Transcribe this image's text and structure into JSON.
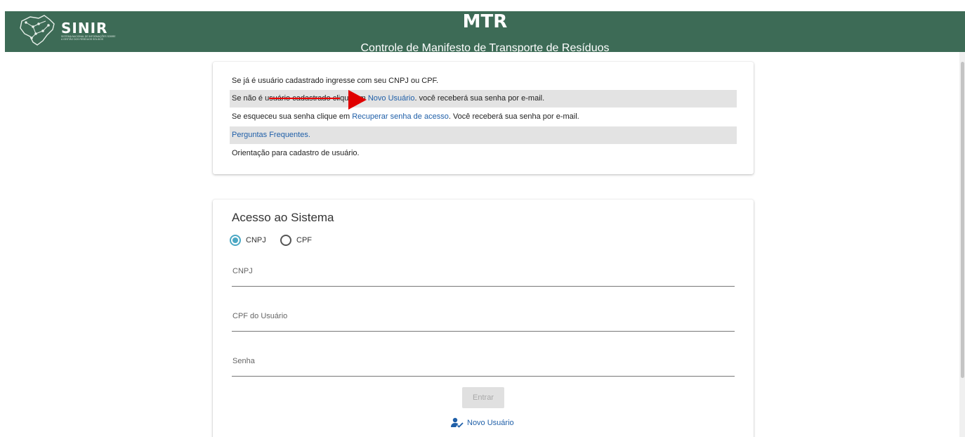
{
  "header": {
    "brand": "SINIR",
    "brand_sub": "Sistema Nacional de Informações sobre a Gestão dos Resíduos Sólidos",
    "title": "MTR",
    "subtitle": "Controle de Manifesto de Transporte de Resíduos"
  },
  "info": {
    "line1": "Se já é usuário cadastrado ingresse com seu CNPJ ou CPF.",
    "line2_pre": "Se não é u",
    "line2_struck": "suário cadastrado cli",
    "line2_mid": "que em ",
    "line2_link": "Novo Usuário",
    "line2_post": ". você receberá sua senha por e-mail.",
    "line3_pre": "Se esqueceu sua senha clique em ",
    "line3_link": "Recuperar senha de acesso",
    "line3_post": ". Você receberá sua senha por e-mail.",
    "line4_link": "Perguntas Frequentes.",
    "line5": "Orientação para cadastro de usuário."
  },
  "login": {
    "title": "Acesso ao Sistema",
    "radio_cnpj": "CNPJ",
    "radio_cpf": "CPF",
    "selected": "CNPJ",
    "field_cnpj": "CNPJ",
    "field_cpf_usuario": "CPF do Usuário",
    "field_senha": "Senha",
    "button_entrar": "Entrar",
    "novo_usuario": "Novo Usuário"
  },
  "colors": {
    "header_bg": "#3d6b56",
    "link": "#1f5fa8",
    "radio_accent": "#4ca8c4",
    "arrow": "#e00000"
  },
  "icons": [
    "brazil-map-logo-icon",
    "user-add-icon"
  ]
}
